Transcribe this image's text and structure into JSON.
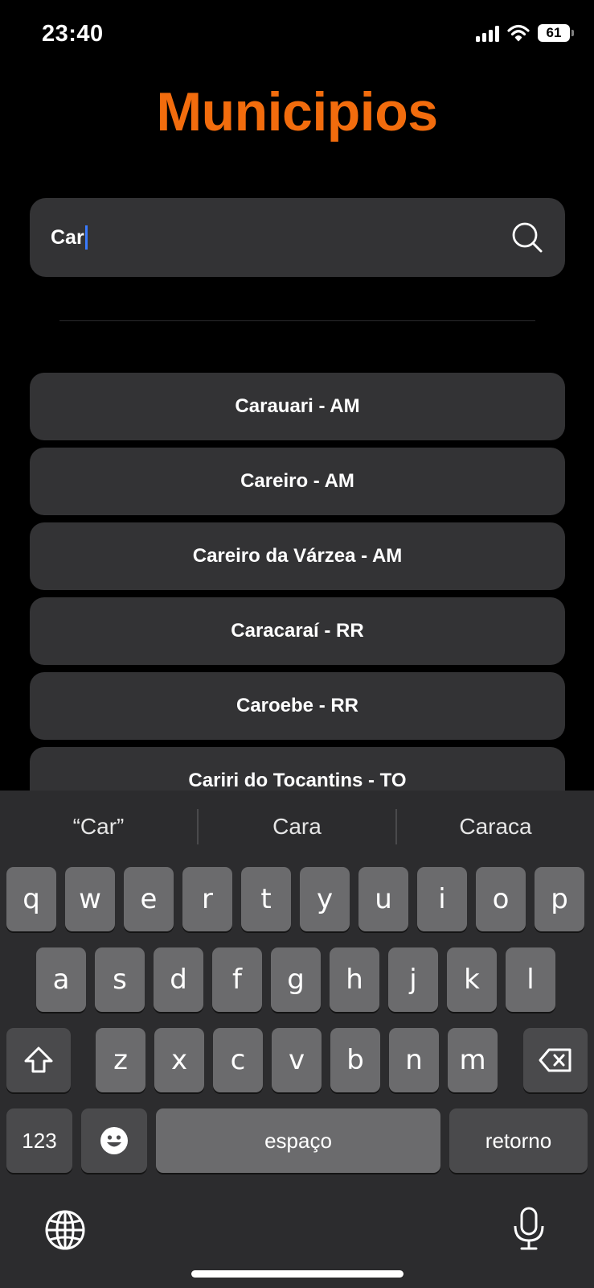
{
  "status_bar": {
    "time": "23:40",
    "battery": "61"
  },
  "title": "Municipios",
  "search": {
    "value": "Car"
  },
  "results": [
    "Carauari - AM",
    "Careiro - AM",
    "Careiro da Várzea - AM",
    "Caracaraí - RR",
    "Caroebe - RR",
    "Cariri do Tocantins - TO"
  ],
  "keyboard": {
    "suggestions": [
      "“Car”",
      "Cara",
      "Caraca"
    ],
    "row1": [
      "q",
      "w",
      "e",
      "r",
      "t",
      "y",
      "u",
      "i",
      "o",
      "p"
    ],
    "row2": [
      "a",
      "s",
      "d",
      "f",
      "g",
      "h",
      "j",
      "k",
      "l"
    ],
    "row3": [
      "z",
      "x",
      "c",
      "v",
      "b",
      "n",
      "m"
    ],
    "numbers_key": "123",
    "space_key": "espaço",
    "return_key": "retorno"
  },
  "colors": {
    "accent": "#f26c0d",
    "caret": "#3a7bff",
    "field": "#333335"
  }
}
